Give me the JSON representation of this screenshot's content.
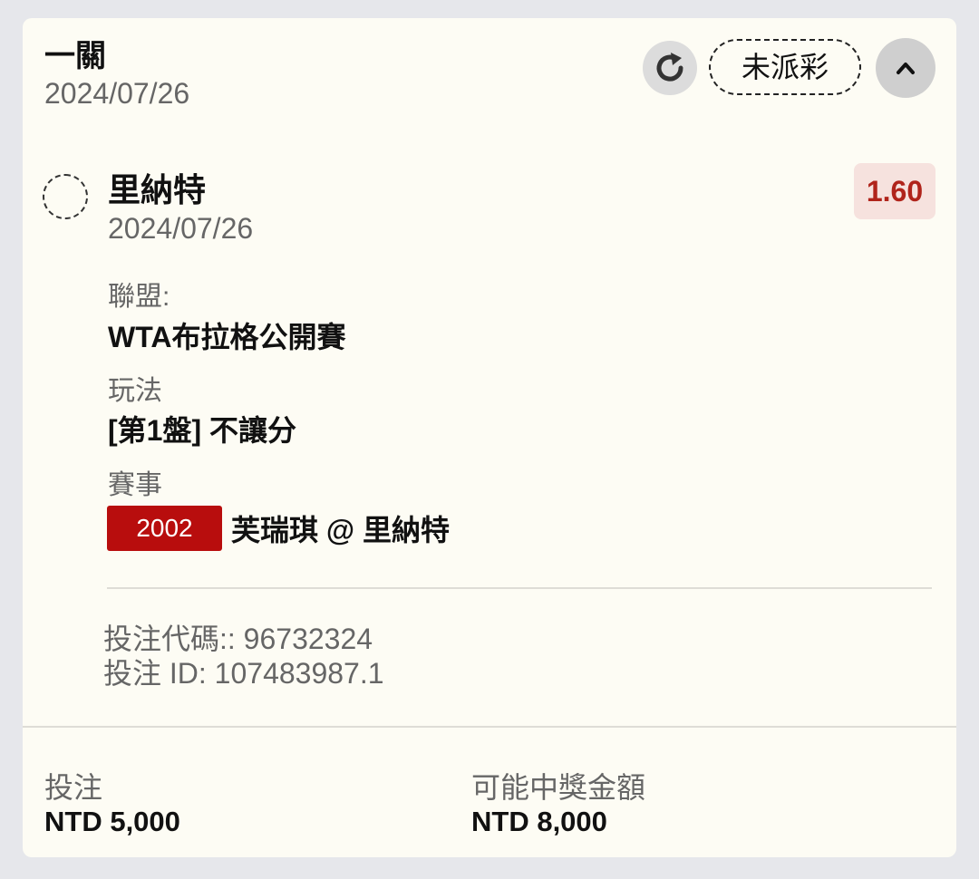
{
  "bet": {
    "title": "一關",
    "date": "2024/07/26",
    "status": "未派彩"
  },
  "selection": {
    "name": "里納特",
    "date": "2024/07/26",
    "odds": "1.60"
  },
  "details": {
    "league_label": "聯盟:",
    "league_value": "WTA布拉格公開賽",
    "bet_type_label": "玩法",
    "bet_type_value": "[第1盤] 不讓分",
    "event_label": "賽事",
    "event_number": "2002",
    "event_match": "芙瑞琪 @ 里納特"
  },
  "codes": {
    "bet_code": "投注代碼:: 96732324",
    "bet_id": "投注 ID: 107483987.1"
  },
  "footer": {
    "stake_label": "投注",
    "stake_value": "NTD 5,000",
    "payout_label": "可能中獎金額",
    "payout_value": "NTD 8,000"
  },
  "icons": {
    "refresh": "refresh-icon",
    "collapse": "chevron-up-icon",
    "selection": "radio-pending-icon"
  },
  "colors": {
    "odds": "#b0241b",
    "event_badge": "#b80d0d",
    "card_bg": "#fdfcf4"
  }
}
